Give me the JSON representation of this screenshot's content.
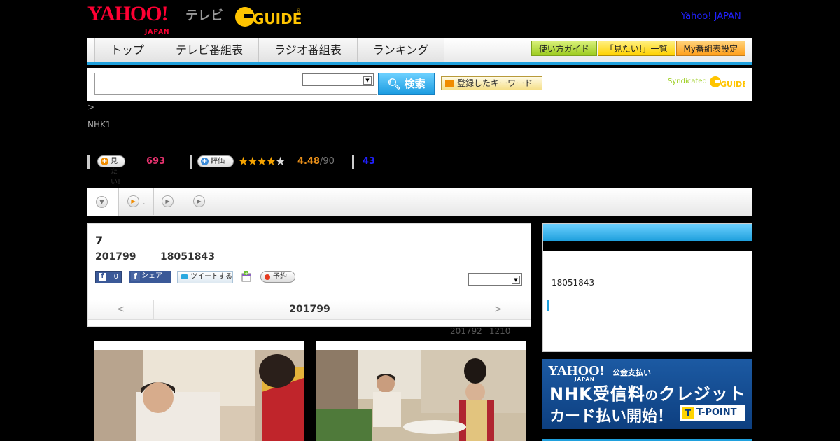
{
  "header": {
    "logo_yahoo": "YAHOO!",
    "logo_japan": "JAPAN",
    "logo_tv": "テレビ",
    "logo_gguide": "G-GUIDE",
    "yahoo_link": "Yahoo! JAPAN"
  },
  "nav": {
    "tabs": [
      "トップ",
      "テレビ番組表",
      "ラジオ番組表",
      "ランキング"
    ],
    "buttons": [
      "使い方ガイド",
      "「見たい!」一覧",
      "My番組表設定"
    ]
  },
  "search": {
    "input_value": "",
    "select_value": "",
    "button_label": "検索",
    "keyword_button": "登録したキーワード",
    "syndicated": "Syndicated",
    "syndicated_logo": "G-GUIDE"
  },
  "breadcrumb": ">",
  "channel": "NHK1",
  "stats": {
    "want_label": "見たい!",
    "want_count": "693",
    "rate_label": "評価",
    "stars_filled": 4,
    "stars_total": 5,
    "rating": "4.48",
    "rating_count": "/90",
    "reviews": "43"
  },
  "tabs": {
    "tab2_label": "."
  },
  "program": {
    "title": "7",
    "date": "201799",
    "time": "18051843",
    "fb_like_count": "0",
    "fb_share": "シェア",
    "tweet": "ツイートする",
    "reserve": "予約",
    "select_value": "",
    "pager_prev": "<",
    "pager_current": "201799",
    "pager_next": ">"
  },
  "update_note": [
    "201792",
    "1210"
  ],
  "sidebar": {
    "time": "18051843"
  },
  "banner": {
    "yahoo": "YAHOO!",
    "japan": "JAPAN",
    "pay": "公金支払い",
    "line1_a": "NHK受信料",
    "line1_b": "の",
    "line1_c": "クレジット",
    "line2": "カード払い開始！",
    "tpoint": "T-POINT"
  },
  "colors": {
    "accent_blue": "#1fa0dd",
    "yahoo_red": "#ff0033",
    "want_pink": "#e6326e",
    "star_orange": "#f5a300"
  }
}
